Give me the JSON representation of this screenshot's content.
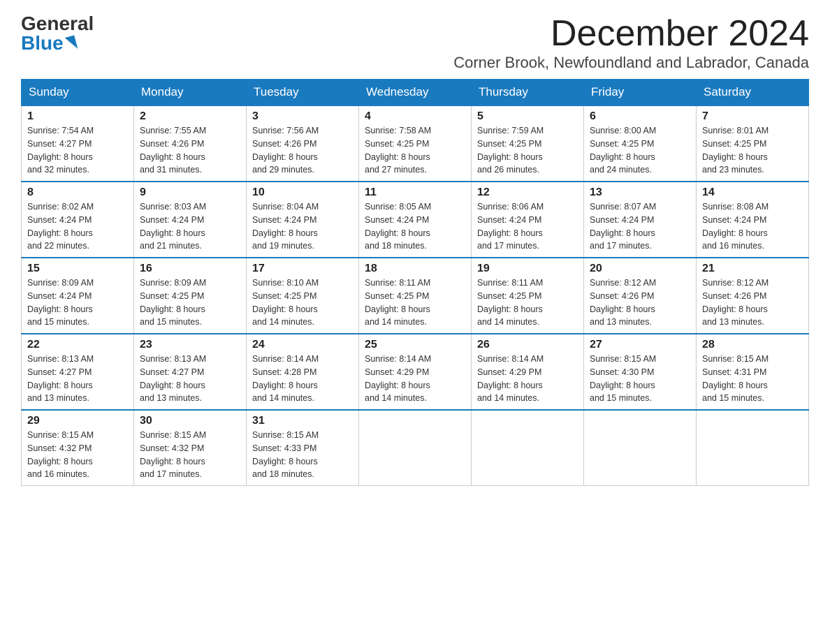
{
  "logo": {
    "general": "General",
    "blue": "Blue"
  },
  "title": "December 2024",
  "location": "Corner Brook, Newfoundland and Labrador, Canada",
  "days_of_week": [
    "Sunday",
    "Monday",
    "Tuesday",
    "Wednesday",
    "Thursday",
    "Friday",
    "Saturday"
  ],
  "weeks": [
    [
      {
        "day": "1",
        "sunrise": "7:54 AM",
        "sunset": "4:27 PM",
        "daylight": "8 hours and 32 minutes."
      },
      {
        "day": "2",
        "sunrise": "7:55 AM",
        "sunset": "4:26 PM",
        "daylight": "8 hours and 31 minutes."
      },
      {
        "day": "3",
        "sunrise": "7:56 AM",
        "sunset": "4:26 PM",
        "daylight": "8 hours and 29 minutes."
      },
      {
        "day": "4",
        "sunrise": "7:58 AM",
        "sunset": "4:25 PM",
        "daylight": "8 hours and 27 minutes."
      },
      {
        "day": "5",
        "sunrise": "7:59 AM",
        "sunset": "4:25 PM",
        "daylight": "8 hours and 26 minutes."
      },
      {
        "day": "6",
        "sunrise": "8:00 AM",
        "sunset": "4:25 PM",
        "daylight": "8 hours and 24 minutes."
      },
      {
        "day": "7",
        "sunrise": "8:01 AM",
        "sunset": "4:25 PM",
        "daylight": "8 hours and 23 minutes."
      }
    ],
    [
      {
        "day": "8",
        "sunrise": "8:02 AM",
        "sunset": "4:24 PM",
        "daylight": "8 hours and 22 minutes."
      },
      {
        "day": "9",
        "sunrise": "8:03 AM",
        "sunset": "4:24 PM",
        "daylight": "8 hours and 21 minutes."
      },
      {
        "day": "10",
        "sunrise": "8:04 AM",
        "sunset": "4:24 PM",
        "daylight": "8 hours and 19 minutes."
      },
      {
        "day": "11",
        "sunrise": "8:05 AM",
        "sunset": "4:24 PM",
        "daylight": "8 hours and 18 minutes."
      },
      {
        "day": "12",
        "sunrise": "8:06 AM",
        "sunset": "4:24 PM",
        "daylight": "8 hours and 17 minutes."
      },
      {
        "day": "13",
        "sunrise": "8:07 AM",
        "sunset": "4:24 PM",
        "daylight": "8 hours and 17 minutes."
      },
      {
        "day": "14",
        "sunrise": "8:08 AM",
        "sunset": "4:24 PM",
        "daylight": "8 hours and 16 minutes."
      }
    ],
    [
      {
        "day": "15",
        "sunrise": "8:09 AM",
        "sunset": "4:24 PM",
        "daylight": "8 hours and 15 minutes."
      },
      {
        "day": "16",
        "sunrise": "8:09 AM",
        "sunset": "4:25 PM",
        "daylight": "8 hours and 15 minutes."
      },
      {
        "day": "17",
        "sunrise": "8:10 AM",
        "sunset": "4:25 PM",
        "daylight": "8 hours and 14 minutes."
      },
      {
        "day": "18",
        "sunrise": "8:11 AM",
        "sunset": "4:25 PM",
        "daylight": "8 hours and 14 minutes."
      },
      {
        "day": "19",
        "sunrise": "8:11 AM",
        "sunset": "4:25 PM",
        "daylight": "8 hours and 14 minutes."
      },
      {
        "day": "20",
        "sunrise": "8:12 AM",
        "sunset": "4:26 PM",
        "daylight": "8 hours and 13 minutes."
      },
      {
        "day": "21",
        "sunrise": "8:12 AM",
        "sunset": "4:26 PM",
        "daylight": "8 hours and 13 minutes."
      }
    ],
    [
      {
        "day": "22",
        "sunrise": "8:13 AM",
        "sunset": "4:27 PM",
        "daylight": "8 hours and 13 minutes."
      },
      {
        "day": "23",
        "sunrise": "8:13 AM",
        "sunset": "4:27 PM",
        "daylight": "8 hours and 13 minutes."
      },
      {
        "day": "24",
        "sunrise": "8:14 AM",
        "sunset": "4:28 PM",
        "daylight": "8 hours and 14 minutes."
      },
      {
        "day": "25",
        "sunrise": "8:14 AM",
        "sunset": "4:29 PM",
        "daylight": "8 hours and 14 minutes."
      },
      {
        "day": "26",
        "sunrise": "8:14 AM",
        "sunset": "4:29 PM",
        "daylight": "8 hours and 14 minutes."
      },
      {
        "day": "27",
        "sunrise": "8:15 AM",
        "sunset": "4:30 PM",
        "daylight": "8 hours and 15 minutes."
      },
      {
        "day": "28",
        "sunrise": "8:15 AM",
        "sunset": "4:31 PM",
        "daylight": "8 hours and 15 minutes."
      }
    ],
    [
      {
        "day": "29",
        "sunrise": "8:15 AM",
        "sunset": "4:32 PM",
        "daylight": "8 hours and 16 minutes."
      },
      {
        "day": "30",
        "sunrise": "8:15 AM",
        "sunset": "4:32 PM",
        "daylight": "8 hours and 17 minutes."
      },
      {
        "day": "31",
        "sunrise": "8:15 AM",
        "sunset": "4:33 PM",
        "daylight": "8 hours and 18 minutes."
      },
      null,
      null,
      null,
      null
    ]
  ],
  "sunrise_label": "Sunrise:",
  "sunset_label": "Sunset:",
  "daylight_label": "Daylight:"
}
